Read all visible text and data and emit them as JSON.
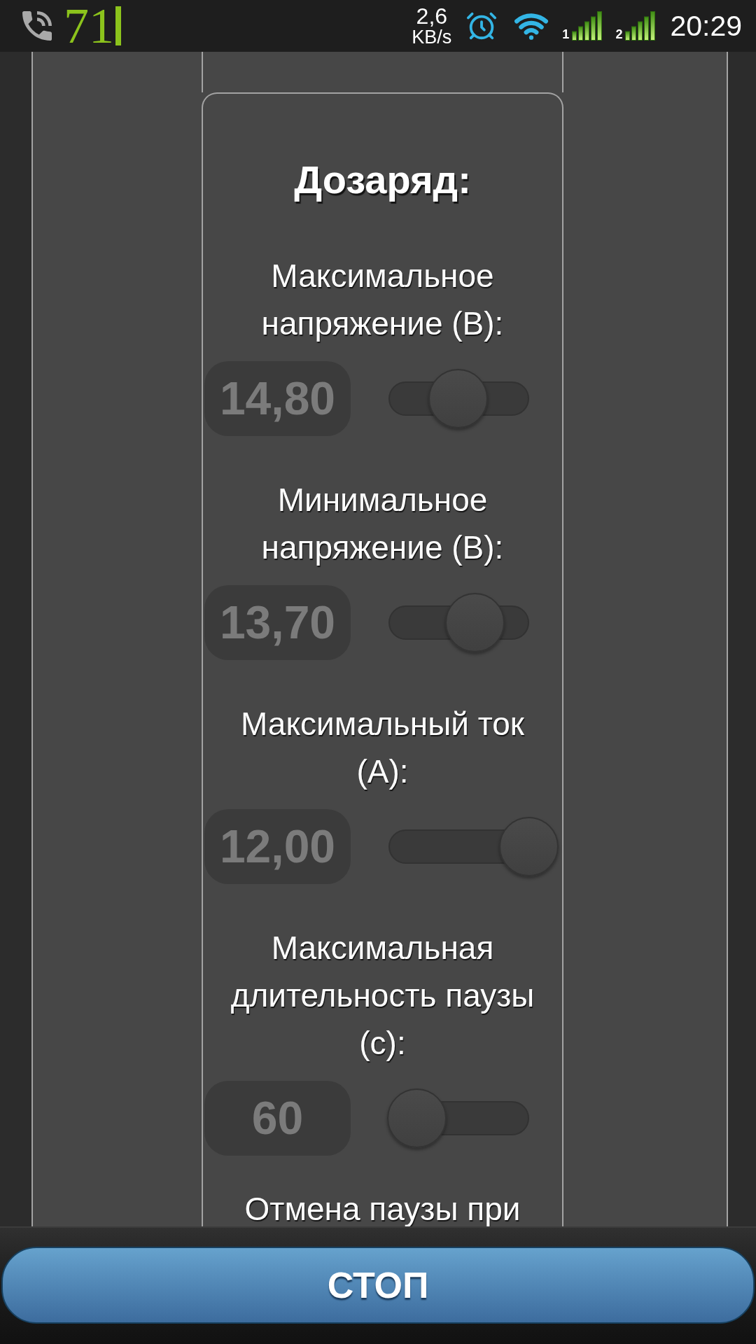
{
  "status_bar": {
    "notification_text": "71",
    "data_rate": "2,6",
    "data_rate_unit": "KB/s",
    "sim_slots": [
      {
        "label": "1"
      },
      {
        "label": "2"
      }
    ],
    "time": "20:29"
  },
  "card": {
    "title": "Дозаряд:",
    "settings": [
      {
        "label": "Максимальное напряжение (В):",
        "value": "14,80",
        "disabled": true,
        "level": 0.37
      },
      {
        "label": "Минимальное напряжение (В):",
        "value": "13,70",
        "disabled": true,
        "level": 0.52
      },
      {
        "label": "Максимальный ток (А):",
        "value": "12,00",
        "disabled": true,
        "level": 1
      },
      {
        "label": "Максимальная длительность паузы (с):",
        "value": "60",
        "disabled": true,
        "level": 0
      }
    ],
    "partial_label": "Отмена паузы при"
  },
  "stop_button": {
    "label": "СТОП"
  }
}
